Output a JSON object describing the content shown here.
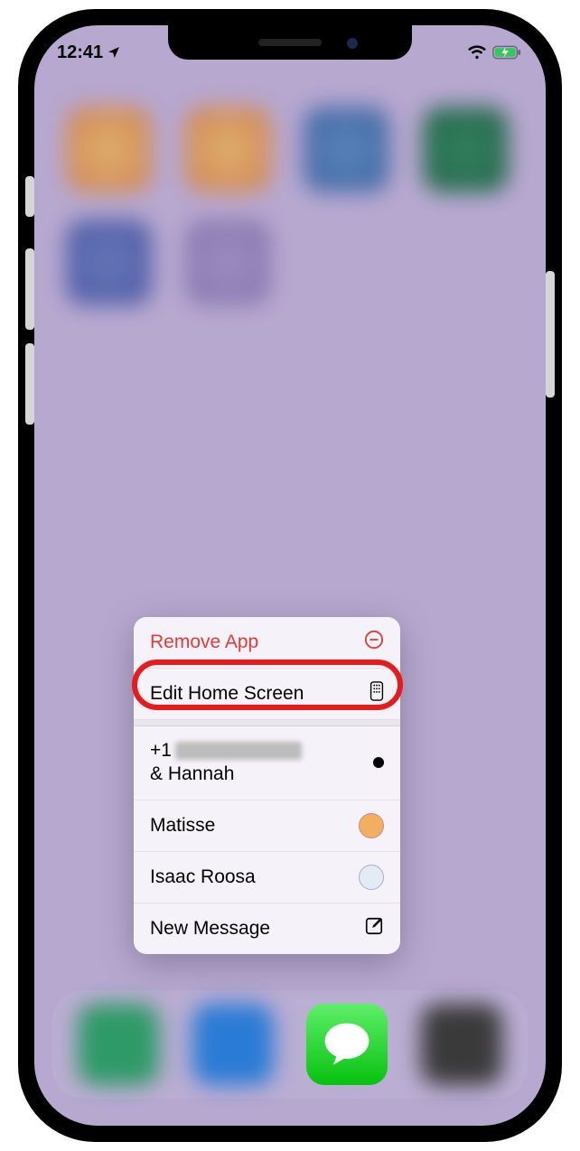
{
  "status": {
    "time": "12:41",
    "wifi": true,
    "battery_charging": true
  },
  "context_menu": {
    "remove_app_label": "Remove App",
    "edit_home_label": "Edit Home Screen",
    "contacts": [
      {
        "line1_prefix": "+1",
        "line2": "& Hannah",
        "has_unread": true
      },
      {
        "name": "Matisse"
      },
      {
        "name": "Isaac Roosa"
      }
    ],
    "new_message_label": "New Message"
  },
  "dock": {
    "messages_app": "Messages"
  },
  "highlighted_item": "Edit Home Screen"
}
